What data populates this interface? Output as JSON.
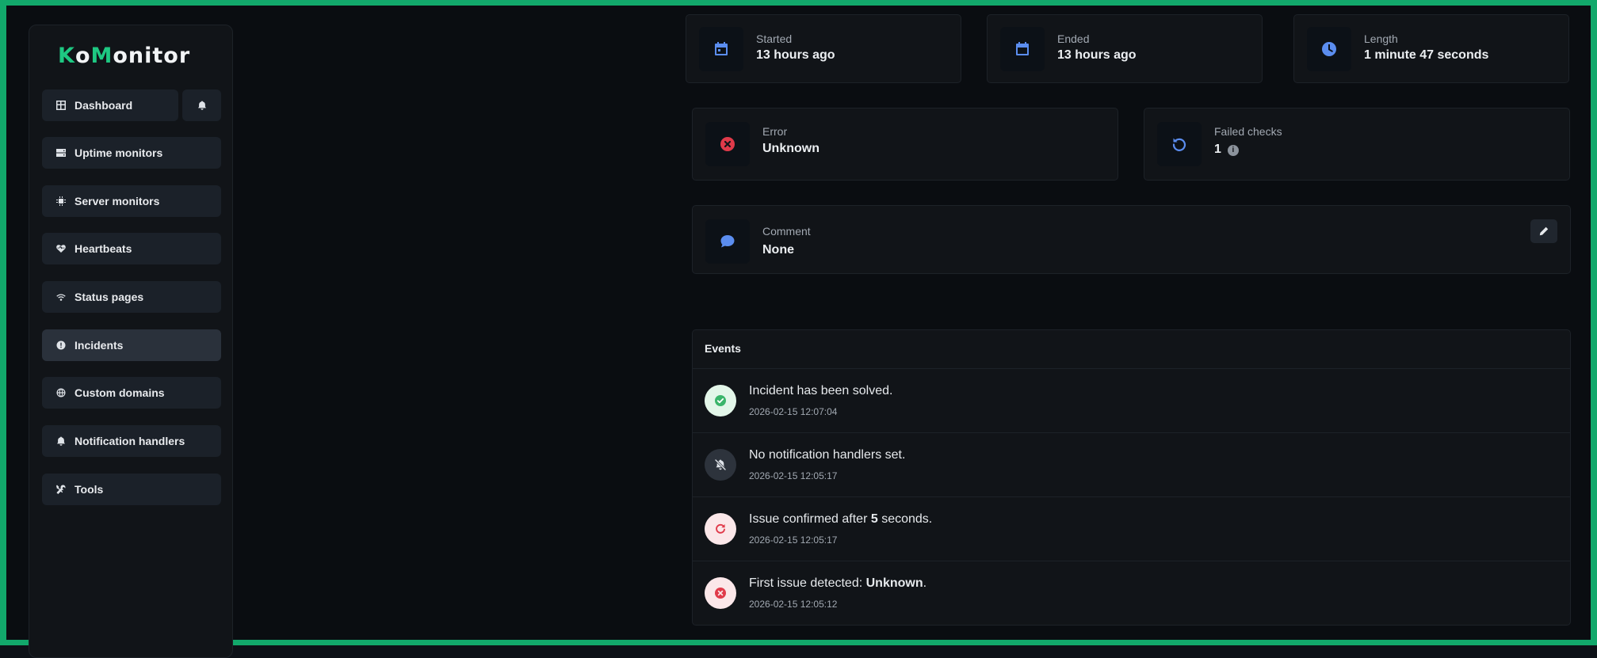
{
  "app": {
    "logo_k": "K",
    "logo_o": "o",
    "logo_m": "M",
    "logo_rest": "onitor"
  },
  "colors": {
    "accent": "#1ec882",
    "frame": "#12a86b",
    "blue": "#5b8def",
    "red": "#e03a4a",
    "green": "#3bb56b"
  },
  "sidebar": {
    "items": [
      {
        "label": "Dashboard",
        "icon": "grid-icon"
      },
      {
        "label": "Uptime monitors",
        "icon": "server-icon"
      },
      {
        "label": "Server monitors",
        "icon": "chip-icon"
      },
      {
        "label": "Heartbeats",
        "icon": "heart-pulse-icon"
      },
      {
        "label": "Status pages",
        "icon": "wifi-icon"
      },
      {
        "label": "Incidents",
        "icon": "exclamation-circle-icon",
        "active": true
      },
      {
        "label": "Custom domains",
        "icon": "globe-icon"
      },
      {
        "label": "Notification handlers",
        "icon": "bell-icon"
      },
      {
        "label": "Tools",
        "icon": "tools-icon"
      }
    ],
    "bell_icon": "bell-icon"
  },
  "stats": {
    "started": {
      "label": "Started",
      "value": "13 hours ago",
      "icon": "calendar-icon"
    },
    "ended": {
      "label": "Ended",
      "value": "13 hours ago",
      "icon": "calendar-icon"
    },
    "length": {
      "label": "Length",
      "value": "1 minute 47 seconds",
      "icon": "clock-icon"
    },
    "error": {
      "label": "Error",
      "value": "Unknown",
      "icon": "x-circle-icon"
    },
    "failed": {
      "label": "Failed checks",
      "value": "1",
      "icon": "rotate-left-icon",
      "info_icon": "info-icon"
    },
    "comment": {
      "label": "Comment",
      "value": "None",
      "icon": "comment-icon",
      "edit_icon": "pencil-icon"
    }
  },
  "events": {
    "title": "Events",
    "items": [
      {
        "pre": "Incident has been solved.",
        "bold": "",
        "post": "",
        "time": "2026-02-15 12:07:04",
        "icon": "check-circle-icon"
      },
      {
        "pre": "No notification handlers set.",
        "bold": "",
        "post": "",
        "time": "2026-02-15 12:05:17",
        "icon": "bell-slash-icon"
      },
      {
        "pre": "Issue confirmed after ",
        "bold": "5",
        "post": " seconds.",
        "time": "2026-02-15 12:05:17",
        "icon": "rotate-right-icon"
      },
      {
        "pre": "First issue detected: ",
        "bold": "Unknown",
        "post": ".",
        "time": "2026-02-15 12:05:12",
        "icon": "x-circle-icon"
      }
    ]
  }
}
